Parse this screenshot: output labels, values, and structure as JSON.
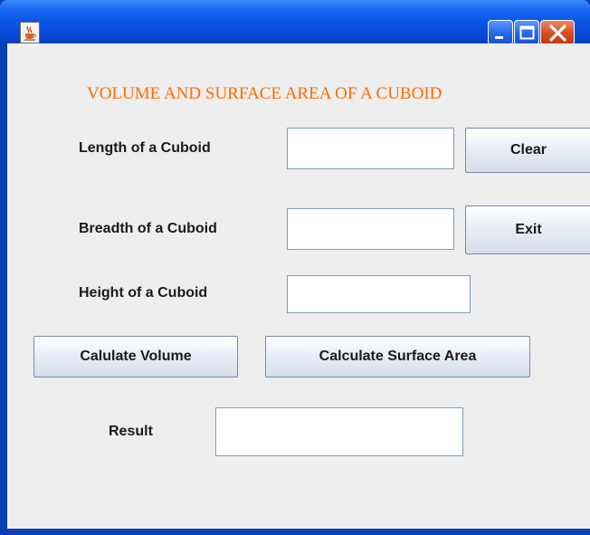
{
  "window": {
    "title": "",
    "icon": "java-coffee-icon",
    "controls": [
      "minimize-icon",
      "maximize-icon",
      "close-icon"
    ]
  },
  "heading": "VOLUME AND SURFACE AREA OF A CUBOID",
  "fields": {
    "length_label": "Length of a Cuboid",
    "length_value": "",
    "breadth_label": "Breadth of a Cuboid",
    "breadth_value": "",
    "height_label": "Height of a Cuboid",
    "height_value": "",
    "result_label": "Result",
    "result_value": ""
  },
  "buttons": {
    "clear": "Clear",
    "exit": "Exit",
    "calc_volume": "Calulate Volume",
    "calc_surface": "Calculate Surface Area"
  },
  "colors": {
    "heading": "#ff6a00",
    "titlebar": "#0a55e6",
    "background": "#eeeeee"
  }
}
